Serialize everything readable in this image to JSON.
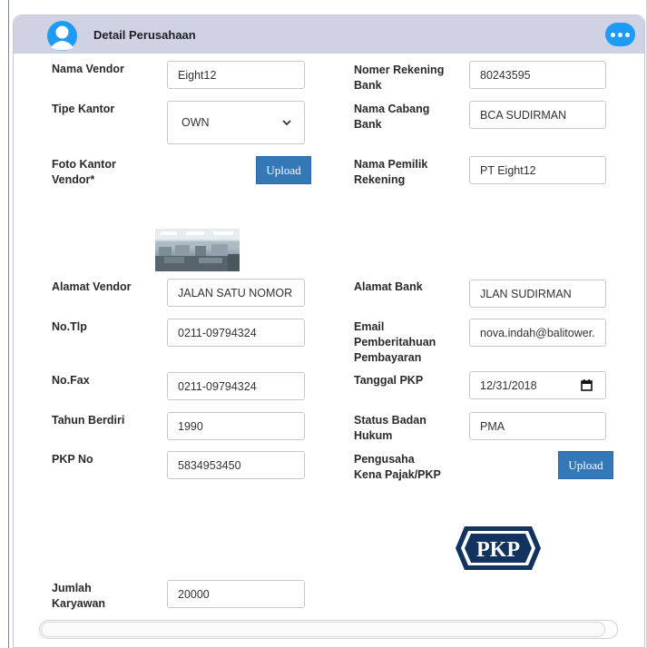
{
  "panel": {
    "title": "Detail Perusahaan",
    "more_icon": "more-horizontal-icon",
    "avatar_icon": "user-avatar-icon"
  },
  "left": {
    "nama_vendor": {
      "label": "Nama Vendor",
      "value": "Eight12"
    },
    "tipe_kantor": {
      "label": "Tipe Kantor",
      "value": "OWN"
    },
    "foto_kantor": {
      "label_1": "Foto Kantor",
      "label_2": "Vendor*",
      "button": "Upload"
    },
    "alamat_vendor": {
      "label": "Alamat Vendor",
      "value": "JALAN SATU NOMOR"
    },
    "no_tlp": {
      "label": "No.Tlp",
      "value": "0211-09794324"
    },
    "no_fax": {
      "label": "No.Fax",
      "value": "0211-09794324"
    },
    "tahun_berdiri": {
      "label": "Tahun Berdiri",
      "value": "1990"
    },
    "pkp_no": {
      "label": "PKP No",
      "value": "5834953450"
    },
    "jumlah_karyawan": {
      "label_1": "Jumlah",
      "label_2": "Karyawan",
      "value": "20000"
    }
  },
  "right": {
    "nomer_rekening": {
      "label_1": "Nomer Rekening",
      "label_2": "Bank",
      "value": "80243595"
    },
    "nama_cabang": {
      "label_1": "Nama Cabang",
      "label_2": "Bank",
      "value": "BCA SUDIRMAN"
    },
    "nama_pemilik": {
      "label_1": "Nama Pemilik",
      "label_2": "Rekening",
      "value": "PT Eight12"
    },
    "alamat_bank": {
      "label": "Alamat Bank",
      "value": "JLAN SUDIRMAN"
    },
    "email": {
      "label_1": "Email",
      "label_2": "Pemberitahuan",
      "label_3": "Pembayaran",
      "value": "nova.indah@balitower."
    },
    "tanggal_pkp": {
      "label": "Tanggal PKP",
      "value": "12/31/2018"
    },
    "status_badan": {
      "label_1": "Status Badan",
      "label_2": "Hukum",
      "value": "PMA"
    },
    "pengusaha_pkp": {
      "label_1": "Pengusaha",
      "label_2": "Kena Pajak/PKP",
      "button": "Upload",
      "logo_text": "PKP"
    }
  },
  "colors": {
    "header_bg": "#cfd2e3",
    "accent_blue": "#1e9bf5",
    "upload_button": "#3478b8",
    "pkp_logo_navy": "#13335f"
  }
}
